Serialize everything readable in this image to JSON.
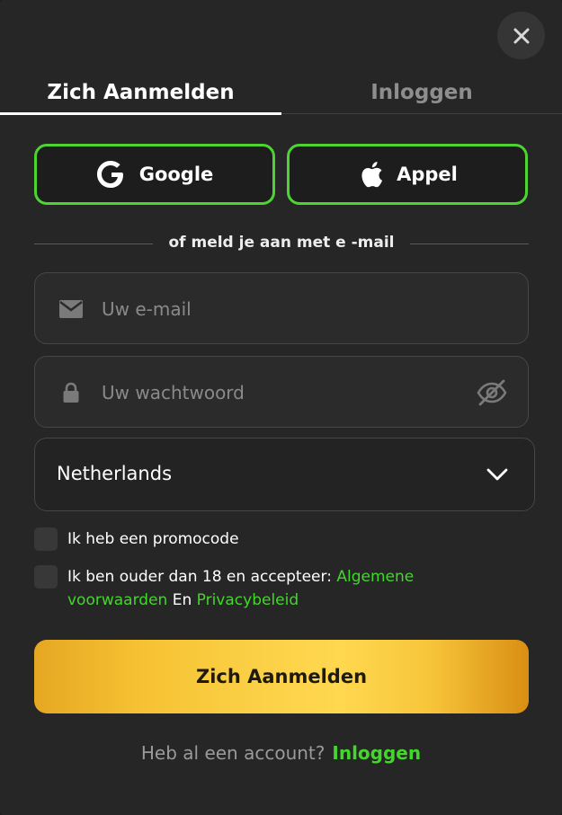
{
  "tabs": [
    {
      "label": "Zich Aanmelden",
      "active": true
    },
    {
      "label": "Inloggen",
      "active": false
    }
  ],
  "social": {
    "google_label": "Google",
    "apple_label": "Appel"
  },
  "divider_text": "of meld je aan met e -mail",
  "email": {
    "placeholder": "Uw e-mail",
    "value": ""
  },
  "password": {
    "placeholder": "Uw wachtwoord",
    "value": ""
  },
  "country": {
    "selected": "Netherlands"
  },
  "checkboxes": {
    "promo_label": "Ik heb een promocode",
    "terms_prefix": "Ik ben ouder dan 18 en accepteer: ",
    "terms_link": "Algemene voorwaarden",
    "terms_and": " En ",
    "privacy_link": "Privacybeleid"
  },
  "submit_label": "Zich Aanmelden",
  "footer": {
    "question": "Heb al een account?",
    "login_link": "Inloggen"
  },
  "colors": {
    "accent_green": "#43d62b",
    "gold": "#fbd046",
    "background": "#262626"
  },
  "icons": [
    "close-icon",
    "google-icon",
    "apple-icon",
    "mail-icon",
    "lock-icon",
    "eye-off-icon",
    "chevron-down-icon"
  ]
}
